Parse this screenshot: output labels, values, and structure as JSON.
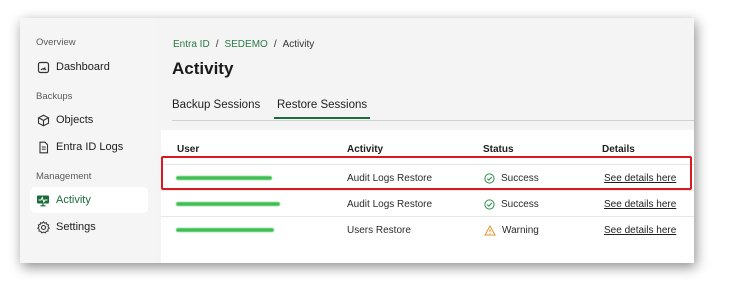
{
  "sidebar": {
    "sections": [
      {
        "label": "Overview",
        "items": [
          {
            "label": "Dashboard",
            "icon": "dashboard-gauge-icon"
          }
        ]
      },
      {
        "label": "Backups",
        "items": [
          {
            "label": "Objects",
            "icon": "cube-icon"
          },
          {
            "label": "Entra ID Logs",
            "icon": "document-log-icon"
          }
        ]
      },
      {
        "label": "Management",
        "items": [
          {
            "label": "Activity",
            "icon": "activity-monitor-icon",
            "active": true
          },
          {
            "label": "Settings",
            "icon": "gear-icon"
          }
        ]
      }
    ]
  },
  "breadcrumb": [
    "Entra ID",
    "SEDEMO",
    "Activity"
  ],
  "page_title": "Activity",
  "tabs": [
    {
      "label": "Backup Sessions",
      "active": false
    },
    {
      "label": "Restore Sessions",
      "active": true
    }
  ],
  "table": {
    "columns": [
      "User",
      "Activity",
      "Status",
      "Details"
    ],
    "rows": [
      {
        "activity": "Audit Logs Restore",
        "status": "Success",
        "status_icon": "success-check-icon",
        "details": "See details here"
      },
      {
        "activity": "Audit Logs Restore",
        "status": "Success",
        "status_icon": "success-check-icon",
        "details": "See details here"
      },
      {
        "activity": "Users Restore",
        "status": "Warning",
        "status_icon": "warning-triangle-icon",
        "details": "See details here"
      }
    ]
  },
  "colors": {
    "accent_green": "#1c6b3a",
    "highlight_red": "#d71920",
    "redaction_green": "#3fbe54",
    "warning_orange": "#e0952b"
  }
}
